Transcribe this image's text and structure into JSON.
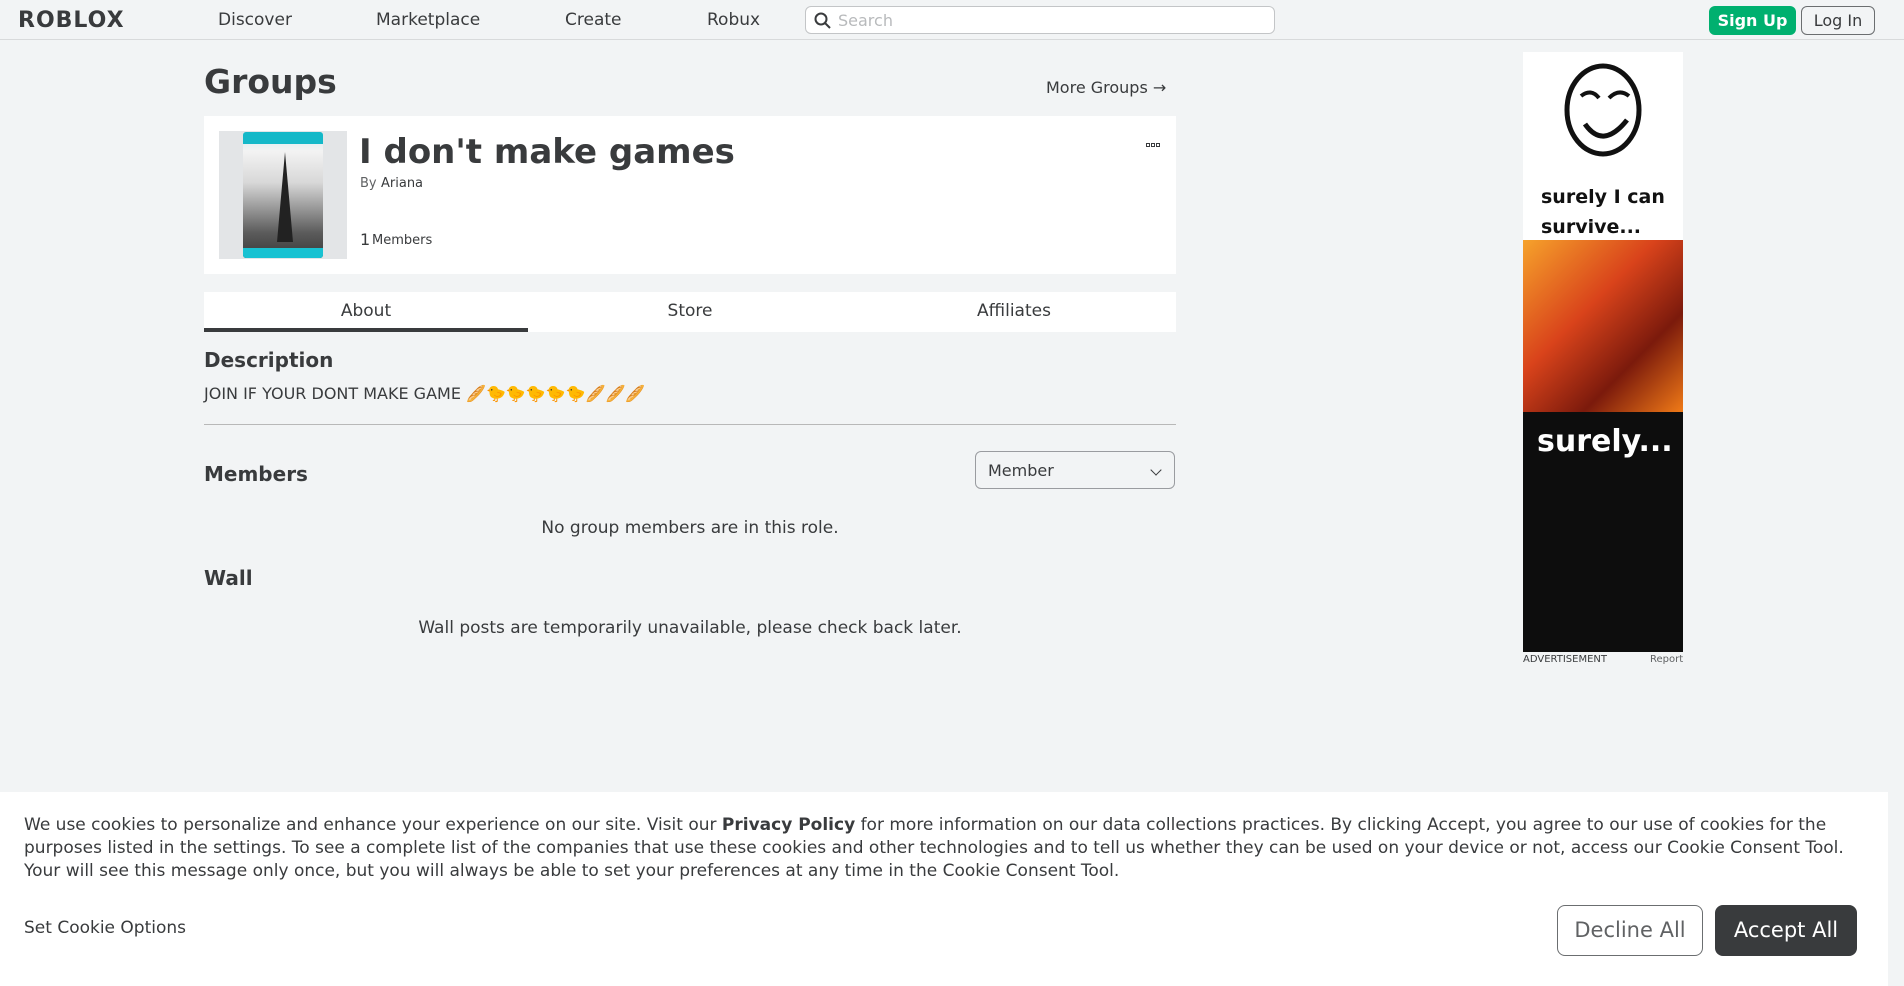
{
  "header": {
    "logo": "ROBLOX",
    "nav": [
      "Discover",
      "Marketplace",
      "Create",
      "Robux"
    ],
    "search_placeholder": "Search",
    "signup_label": "Sign Up",
    "login_label": "Log In"
  },
  "page": {
    "title": "Groups",
    "more_groups": "More Groups →"
  },
  "group": {
    "name": "I don't make games",
    "by_label": "By",
    "owner": "Ariana",
    "members_count": "1",
    "members_label": "Members"
  },
  "tabs": [
    "About",
    "Store",
    "Affiliates"
  ],
  "about": {
    "description_title": "Description",
    "description_text": "JOIN IF YOUR DONT MAKE GAME 🥖🐤🐤🐤🐤🐤🥖🥖🥖",
    "members_title": "Members",
    "role_selected": "Member",
    "no_members": "No group members are in this role.",
    "wall_title": "Wall",
    "wall_message": "Wall posts are temporarily unavailable, please check back later."
  },
  "ad": {
    "text1": "surely I can survive...",
    "text2": "surely...",
    "label": "ADVERTISEMENT",
    "report": "Report"
  },
  "cookie": {
    "text_before": "We use cookies to personalize and enhance your experience on our site. Visit our ",
    "privacy_link": "Privacy Policy",
    "text_after": " for more information on our data collections practices. By clicking Accept, you agree to our use of cookies for the purposes listed in the settings. To see a complete list of the companies that use these cookies and other technologies and to tell us whether they can be used on your device or not, access our Cookie Consent Tool. Your will see this message only once, but you will always be able to set your preferences at any time in the Cookie Consent Tool.",
    "options_label": "Set Cookie Options",
    "decline_label": "Decline All",
    "accept_label": "Accept All"
  },
  "colors": {
    "accent_green": "#00b06f",
    "text_dark": "#393b3d",
    "background": "#f2f4f5"
  }
}
